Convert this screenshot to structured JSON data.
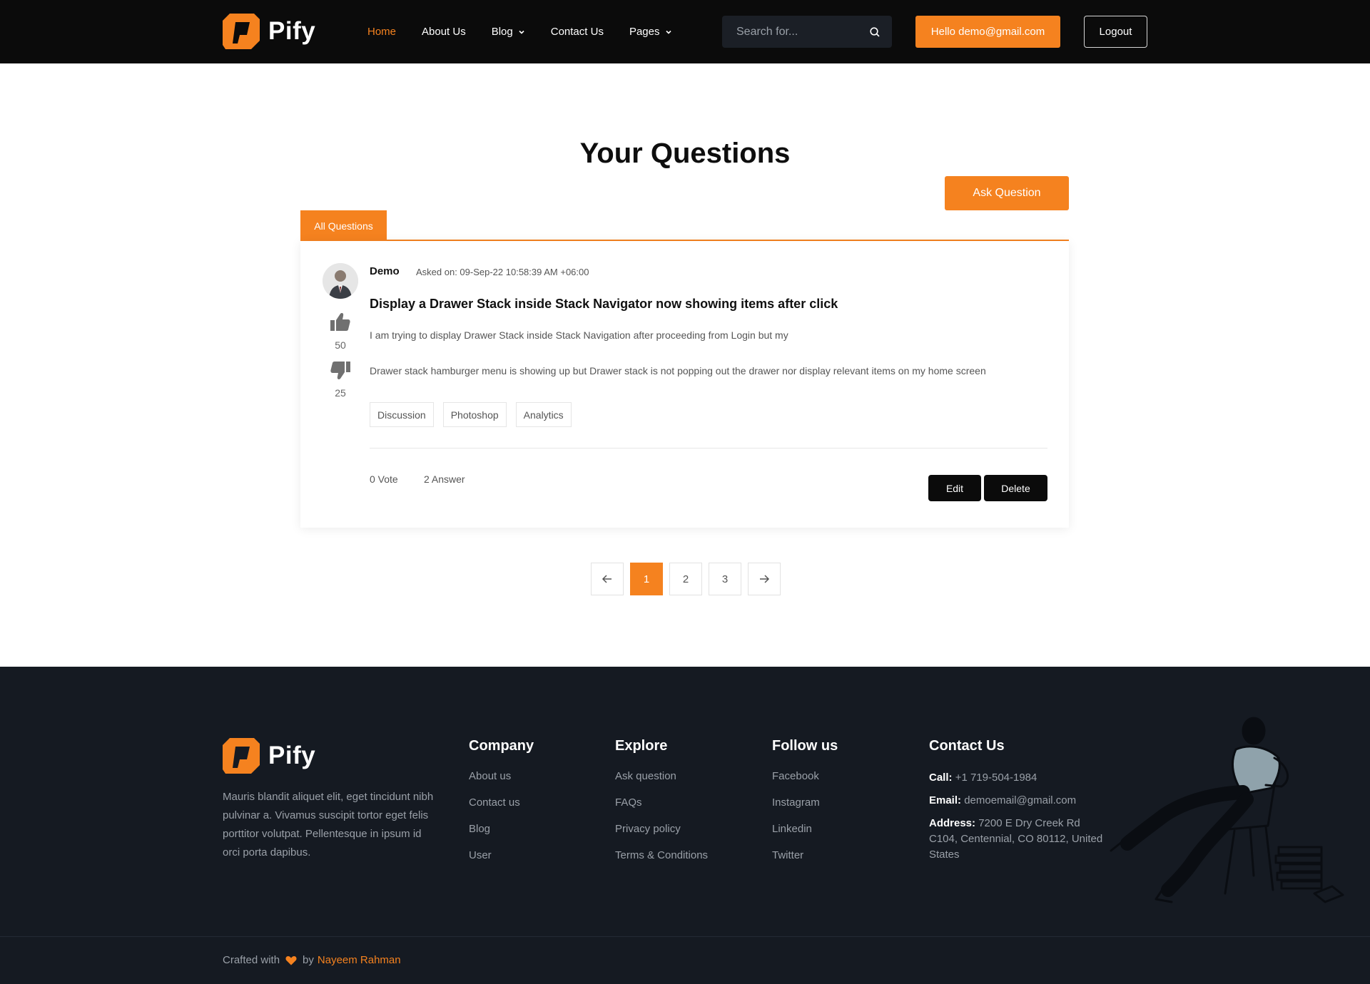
{
  "header": {
    "brand": "Pify",
    "nav": [
      {
        "label": "Home",
        "active": true
      },
      {
        "label": "About Us"
      },
      {
        "label": "Blog",
        "dropdown": true
      },
      {
        "label": "Contact Us"
      },
      {
        "label": "Pages",
        "dropdown": true
      }
    ],
    "search_placeholder": "Search for...",
    "hello_label": "Hello demo@gmail.com",
    "logout_label": "Logout"
  },
  "main": {
    "title": "Your Questions",
    "ask_label": "Ask Question",
    "tab_label": "All Questions",
    "question": {
      "author": "Demo",
      "asked": "Asked on: 09-Sep-22 10:58:39 AM +06:00",
      "upvotes": "50",
      "downvotes": "25",
      "title": "Display a Drawer Stack inside Stack Navigator now showing items after click",
      "body_line1": "I am trying to display Drawer Stack inside Stack Navigation after proceeding from Login but my",
      "body_line2": "Drawer stack hamburger menu is showing up but Drawer stack is not popping out the drawer nor display relevant items on my home screen",
      "tags": [
        "Discussion",
        "Photoshop",
        "Analytics"
      ],
      "vote_count": "0 Vote",
      "answer_count": "2 Answer",
      "edit_label": "Edit",
      "delete_label": "Delete"
    },
    "pagination": {
      "pages": [
        "1",
        "2",
        "3"
      ],
      "current": "1"
    }
  },
  "footer": {
    "brand": "Pify",
    "about": "Mauris blandit aliquet elit, eget tincidunt nibh pulvinar a. Vivamus suscipit tortor eget felis porttitor volutpat. Pellentesque in ipsum id orci porta dapibus.",
    "company": {
      "heading": "Company",
      "links": [
        "About us",
        "Contact us",
        "Blog",
        "User"
      ]
    },
    "explore": {
      "heading": "Explore",
      "links": [
        "Ask question",
        "FAQs",
        "Privacy policy",
        "Terms & Conditions"
      ]
    },
    "follow": {
      "heading": "Follow us",
      "links": [
        "Facebook",
        "Instagram",
        "Linkedin",
        "Twitter"
      ]
    },
    "contact": {
      "heading": "Contact Us",
      "call_label": "Call:",
      "call_value": "+1 719-504-1984",
      "email_label": "Email:",
      "email_value": "demoemail@gmail.com",
      "address_label": "Address:",
      "address_value": "7200 E Dry Creek Rd C104, Centennial, CO 80112, United States"
    },
    "credit_prefix": "Crafted with",
    "credit_by": "by",
    "credit_author": "Nayeem Rahman"
  },
  "colors": {
    "accent": "#f5821f",
    "header_bg": "#0b0b0b",
    "footer_bg": "#151a22"
  }
}
